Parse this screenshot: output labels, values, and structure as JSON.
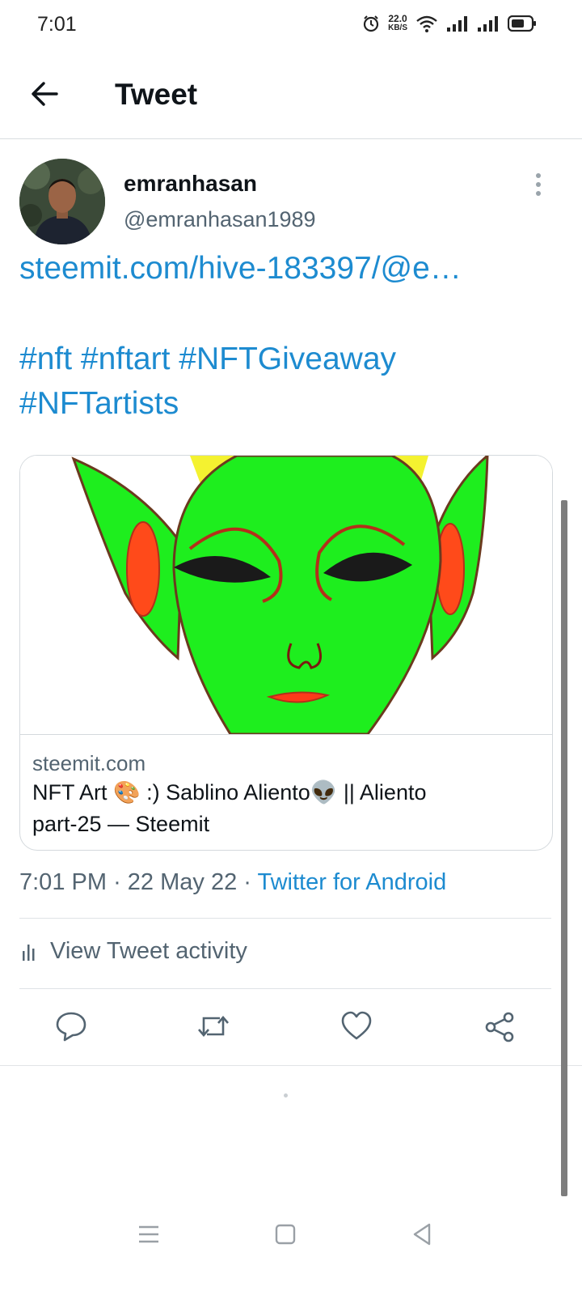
{
  "status_bar": {
    "time": "7:01",
    "speed_value": "22.0",
    "speed_unit": "KB/S",
    "icons": [
      "alarm-icon",
      "wifi-icon",
      "signal-icon",
      "signal-icon",
      "battery-icon"
    ]
  },
  "header": {
    "title": "Tweet",
    "back_icon": "arrow-left-icon"
  },
  "author": {
    "name": "emranhasan",
    "handle": "@emranhasan1989",
    "menu_icon": "more-vertical-icon"
  },
  "tweet": {
    "link": "steemit.com/hive-183397/@e…",
    "hashtags_line1": "#nft #nftart #NFTGiveaway",
    "hashtags_line2": "#NFTartists"
  },
  "card": {
    "domain": "steemit.com",
    "title_line1": "NFT Art 🎨 :) Sablino Aliento👽 || Aliento",
    "title_line2": "part-25 — Steemit"
  },
  "meta": {
    "time": "7:01 PM",
    "date": "22 May 22",
    "separator": "·",
    "source": "Twitter for Android"
  },
  "activity": {
    "label": "View Tweet activity",
    "icon": "bar-chart-icon"
  },
  "actions": {
    "icons": [
      "reply-icon",
      "retweet-icon",
      "like-icon",
      "share-icon"
    ]
  },
  "nav_bar": {
    "icons": [
      "menu-icon",
      "home-square-icon",
      "back-triangle-icon"
    ]
  },
  "colors": {
    "link": "#1d8bd0",
    "secondary_text": "#536471",
    "primary_text": "#0f1419",
    "alien_green": "#1eee1e"
  }
}
